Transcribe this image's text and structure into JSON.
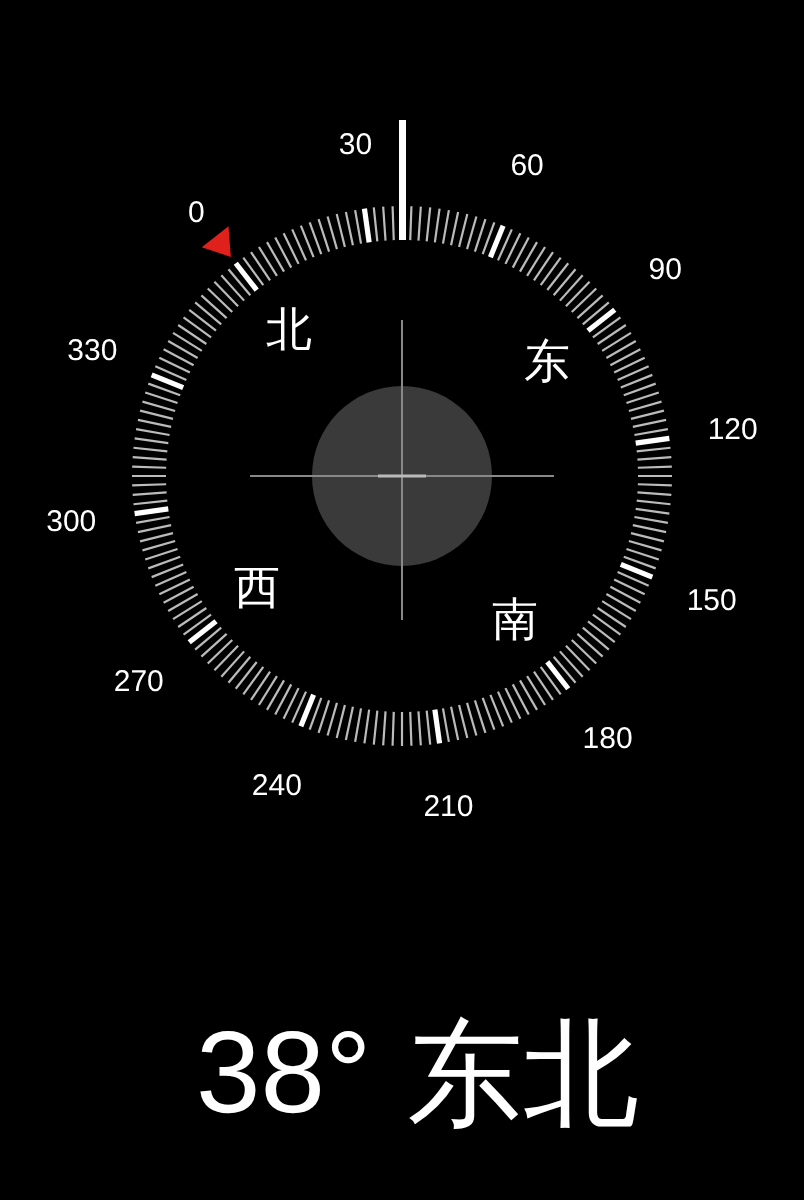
{
  "compass": {
    "degree_labels": [
      "0",
      "30",
      "60",
      "90",
      "120",
      "150",
      "180",
      "210",
      "240",
      "270",
      "300",
      "330"
    ],
    "cardinal_labels": [
      "北",
      "东",
      "南",
      "西"
    ]
  },
  "heading": {
    "reading": "38°",
    "direction": "东北"
  }
}
